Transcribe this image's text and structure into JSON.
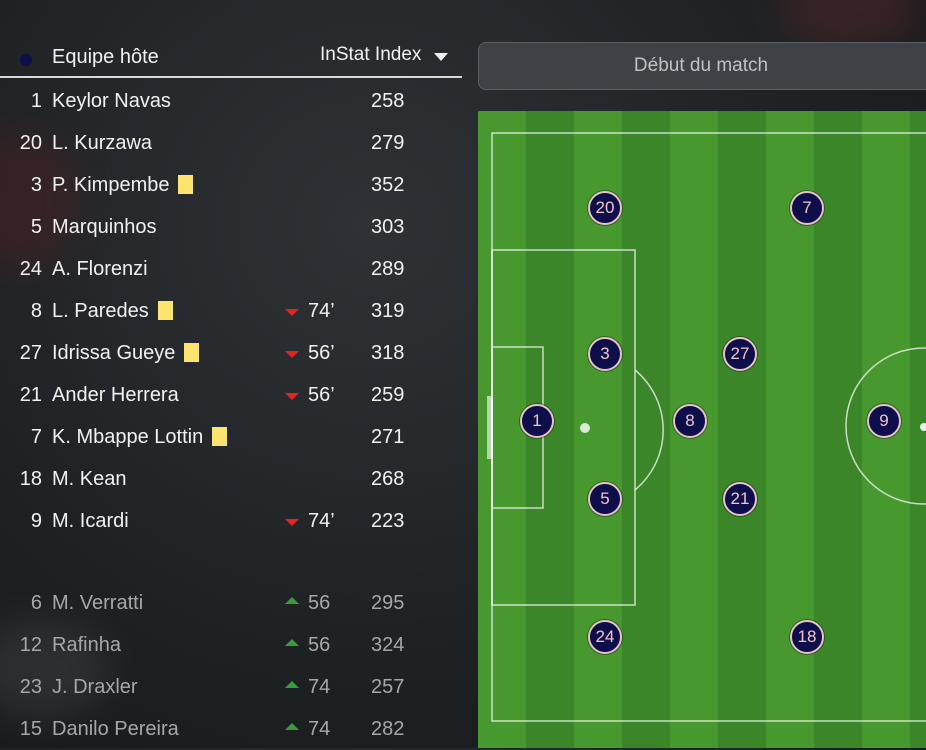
{
  "team": {
    "name": "Equipe hôte",
    "dot_color": "#0e0e4a"
  },
  "sort": {
    "label": "InStat Index"
  },
  "match_button": {
    "label": "Début du match"
  },
  "starters": [
    {
      "number": "1",
      "name": "Keylor Navas",
      "card": false,
      "sub": null,
      "minute": "",
      "index": "258"
    },
    {
      "number": "20",
      "name": "L. Kurzawa",
      "card": false,
      "sub": null,
      "minute": "",
      "index": "279"
    },
    {
      "number": "3",
      "name": "P. Kimpembe",
      "card": true,
      "sub": null,
      "minute": "",
      "index": "352"
    },
    {
      "number": "5",
      "name": "Marquinhos",
      "card": false,
      "sub": null,
      "minute": "",
      "index": "303"
    },
    {
      "number": "24",
      "name": "A. Florenzi",
      "card": false,
      "sub": null,
      "minute": "",
      "index": "289"
    },
    {
      "number": "8",
      "name": "L. Paredes",
      "card": true,
      "sub": "out",
      "minute": "74’",
      "index": "319"
    },
    {
      "number": "27",
      "name": "Idrissa Gueye",
      "card": true,
      "sub": "out",
      "minute": "56’",
      "index": "318"
    },
    {
      "number": "21",
      "name": "Ander Herrera",
      "card": false,
      "sub": "out",
      "minute": "56’",
      "index": "259"
    },
    {
      "number": "7",
      "name": "K. Mbappe Lottin",
      "card": true,
      "sub": null,
      "minute": "",
      "index": "271"
    },
    {
      "number": "18",
      "name": "M. Kean",
      "card": false,
      "sub": null,
      "minute": "",
      "index": "268"
    },
    {
      "number": "9",
      "name": "M. Icardi",
      "card": false,
      "sub": "out",
      "minute": "74’",
      "index": "223"
    }
  ],
  "bench": [
    {
      "number": "6",
      "name": "M. Verratti",
      "sub": "in",
      "minute": "56",
      "index": "295"
    },
    {
      "number": "12",
      "name": "Rafinha",
      "sub": "in",
      "minute": "56",
      "index": "324"
    },
    {
      "number": "23",
      "name": "J. Draxler",
      "sub": "in",
      "minute": "74",
      "index": "257"
    },
    {
      "number": "15",
      "name": "Danilo Pereira",
      "sub": "in",
      "minute": "74",
      "index": "282"
    }
  ],
  "pitch_players": [
    "20",
    "7",
    "3",
    "27",
    "1",
    "8",
    "9",
    "5",
    "21",
    "24",
    "18"
  ],
  "colors": {
    "pitch_light": "#47982f",
    "pitch_dark": "#3a8628",
    "marker_fill": "#0e0e4a",
    "card_yellow": "#fce46e",
    "sub_out": "#e0261d",
    "sub_in": "#3a9a3e"
  }
}
